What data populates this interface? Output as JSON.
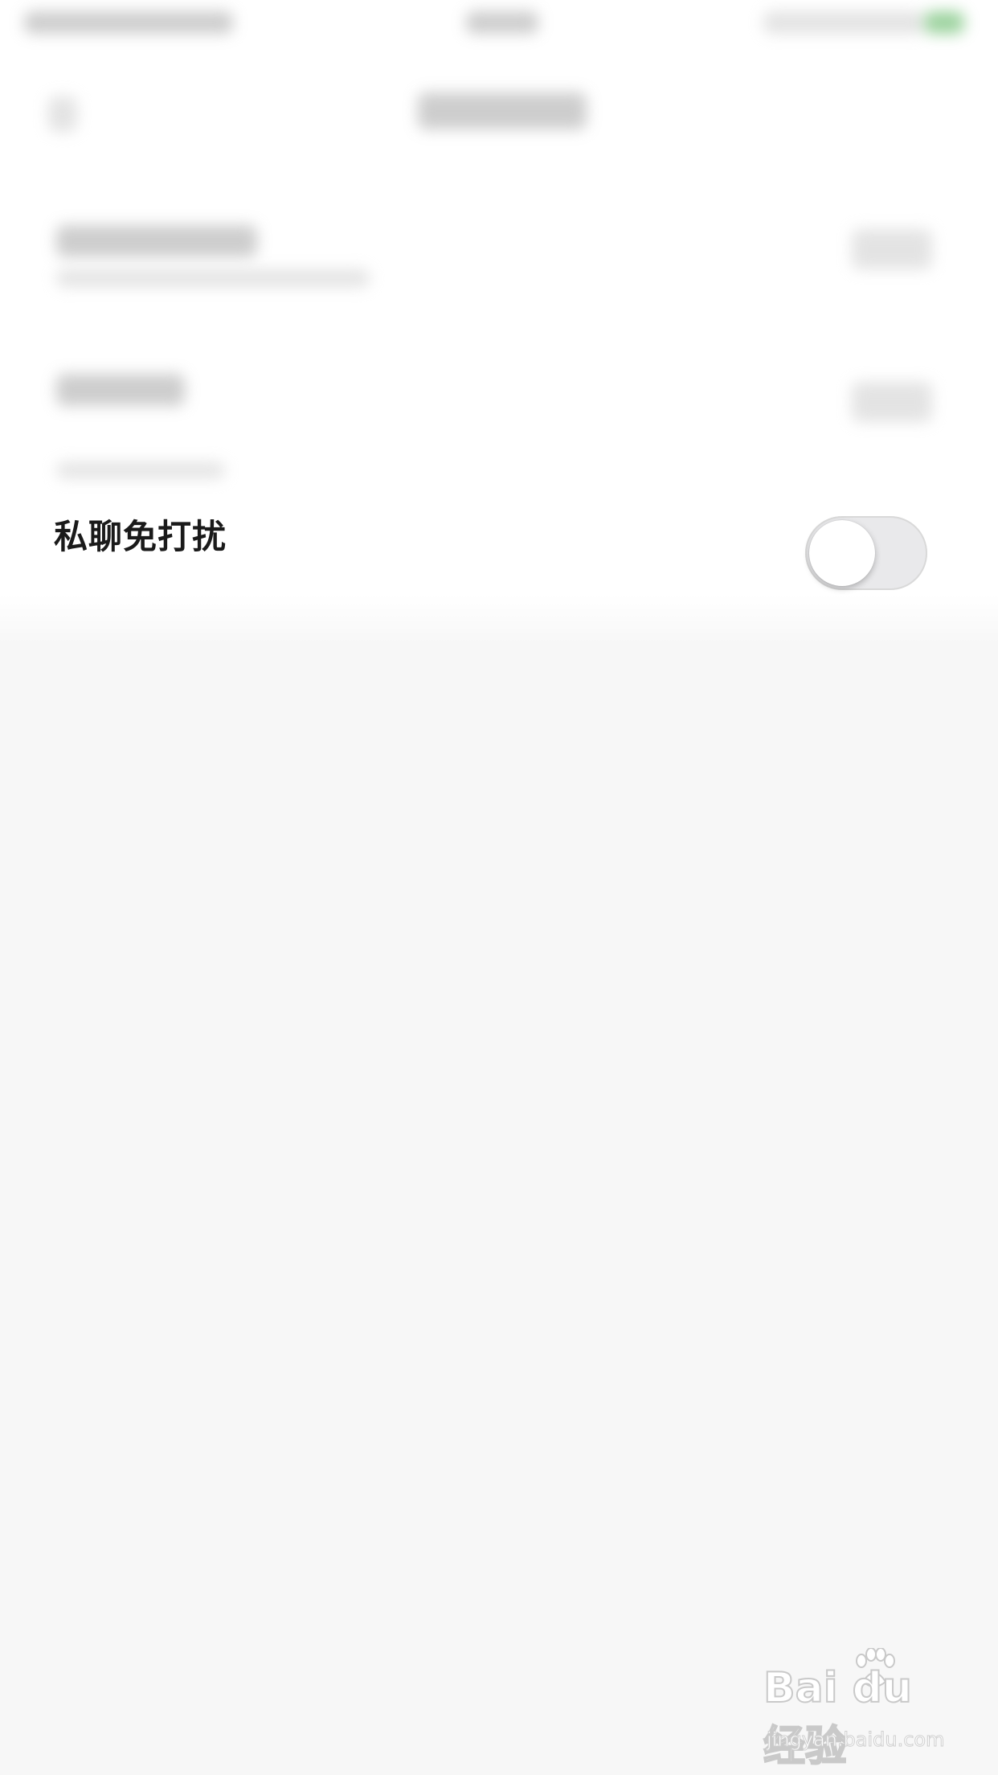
{
  "settings": {
    "private_chat_dnd": {
      "label": "私聊免打扰",
      "enabled": false
    }
  },
  "watermark": {
    "logo_text": "Bai du 经验",
    "url_text": "jingyan.baidu.com"
  },
  "colors": {
    "background": "#f7f7f7",
    "panel": "#ffffff",
    "toggle_off_track": "#e9e9eb",
    "label_text": "#1a1a1a"
  }
}
